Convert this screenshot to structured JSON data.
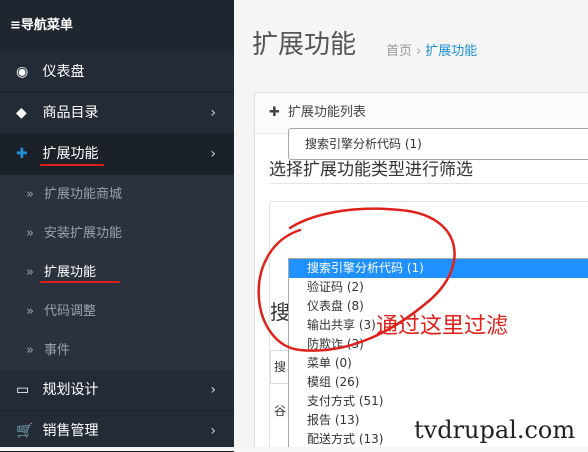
{
  "sidebar": {
    "header": "≡导航菜单",
    "items": [
      {
        "label": "仪表盘",
        "icon": "dashboard-icon",
        "glyph": "◉",
        "chevron": false
      },
      {
        "label": "商品目录",
        "icon": "tag-icon",
        "glyph": "◆",
        "chevron": true
      },
      {
        "label": "扩展功能",
        "icon": "puzzle-icon",
        "glyph": "✚",
        "chevron": true
      },
      {
        "label": "规划设计",
        "icon": "monitor-icon",
        "glyph": "▭",
        "chevron": true
      },
      {
        "label": "销售管理",
        "icon": "cart-icon",
        "glyph": "🛒",
        "chevron": true
      }
    ],
    "sub_items": [
      "扩展功能商城",
      "安装扩展功能",
      "扩展功能",
      "代码调整",
      "事件"
    ],
    "chevron": "›",
    "raquo": "»"
  },
  "main": {
    "title": "扩展功能",
    "breadcrumb": {
      "home": "首页",
      "sep": "›",
      "current": "扩展功能"
    },
    "panel_title": "扩展功能列表",
    "filter_title": "选择扩展功能类型进行筛选",
    "select_value": "搜索引擎分析代码 (1)",
    "options": [
      "搜索引擎分析代码 (1)",
      "验证码 (2)",
      "仪表盘 (8)",
      "输出共享 (3)",
      "防欺诈 (3)",
      "菜单 (0)",
      "模组 (26)",
      "支付方式 (51)",
      "报告 (13)",
      "配送方式 (13)"
    ],
    "selected_index": 0,
    "partial_heading": "搜",
    "partial_tab": "搜",
    "partial_row": "谷"
  },
  "annotation": "通过这里过滤",
  "watermark": "tvdrupal.com",
  "colors": {
    "accent": "#1e90d6",
    "annotation_red": "#e0201b",
    "sidebar_bg": "#232c36"
  }
}
